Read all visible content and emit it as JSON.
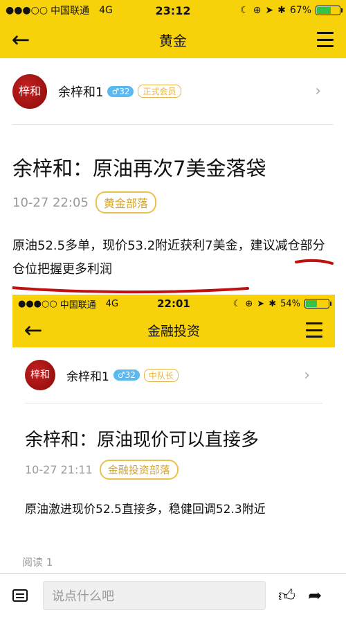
{
  "status": {
    "signal": "●●●○○",
    "carrier": "中国联通",
    "network": "4G",
    "time": "23:12",
    "battery_percent": "67%",
    "battery_level": 0.67
  },
  "nav": {
    "back_icon": "arrow-left-icon",
    "title": "黄金",
    "menu_icon": "hamburger-icon"
  },
  "author": {
    "avatar_text": "梓和",
    "name": "余梓和1",
    "gender_level": "♂32",
    "member_badge": "正式会员",
    "chevron": "›"
  },
  "article": {
    "title": "余梓和：原油再次7美金落袋",
    "datetime": "10-27 22:05",
    "tag": "黄金部落",
    "body": "原油52.5多单，现价53.2附近获利7美金，建议减仓部分仓位把握更多利润"
  },
  "screenshot": {
    "status": {
      "signal": "●●●○○",
      "carrier": "中国联通",
      "network": "4G",
      "time": "22:01",
      "battery_percent": "54%",
      "battery_level": 0.54
    },
    "nav": {
      "title": "金融投资"
    },
    "author": {
      "avatar_text": "梓和",
      "name": "余梓和1",
      "gender_level": "♂32",
      "member_badge": "中队长",
      "chevron": "›"
    },
    "article": {
      "title": "余梓和：原油现价可以直接多",
      "datetime": "10-27 21:11",
      "tag": "金融投资部落",
      "body": "原油激进现价52.5直接多，稳健回调52.3附近"
    }
  },
  "reads": "阅读 1",
  "bottom": {
    "comment_placeholder": "说点什么吧",
    "like_icon": "thumbs-up-icon",
    "share_icon": "share-icon",
    "list_icon": "list-icon"
  },
  "colors": {
    "brand_yellow": "#f7d20a",
    "tag_gold": "#e8c34c",
    "underline_red": "#c01010"
  }
}
